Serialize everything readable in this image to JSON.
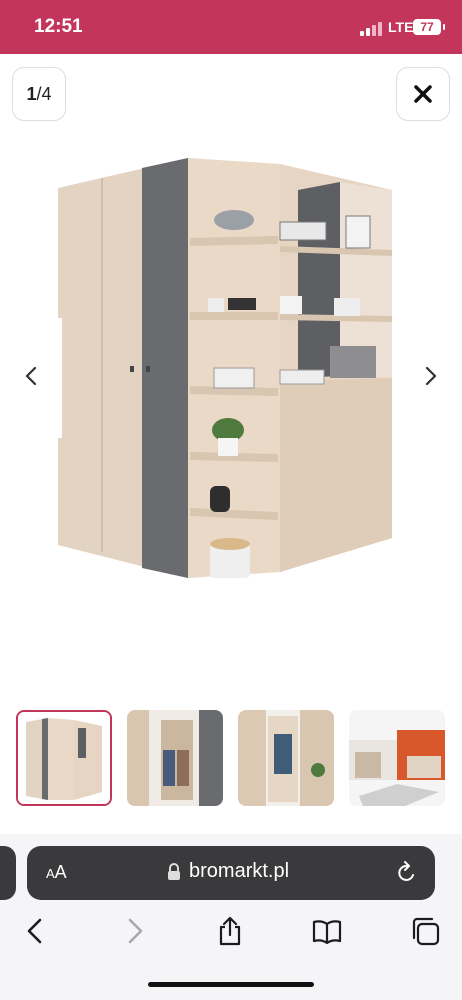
{
  "status_bar": {
    "time": "12:51",
    "network": "LTE",
    "battery": "77"
  },
  "gallery": {
    "current": "1",
    "total": "/4"
  },
  "browser": {
    "aa_big": "A",
    "aa_small": "A",
    "url": "bromarkt.pl"
  },
  "colors": {
    "accent": "#c3355a",
    "urlbar": "#3a3a3c"
  },
  "icons": [
    "close-icon",
    "chevron-left-icon",
    "chevron-right-icon",
    "lock-icon",
    "reload-icon",
    "back-icon",
    "forward-icon",
    "share-icon",
    "bookmarks-icon",
    "tabs-icon"
  ]
}
